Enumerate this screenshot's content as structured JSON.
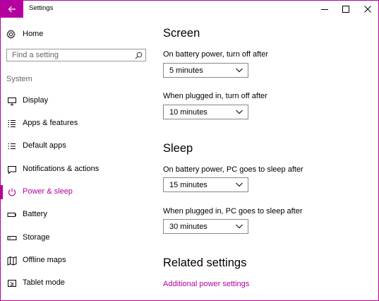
{
  "window": {
    "title": "Settings",
    "accent": "#b4009e"
  },
  "sidebar": {
    "home_label": "Home",
    "search_placeholder": "Find a setting",
    "section_label": "System",
    "items": [
      {
        "label": "Display",
        "icon": "monitor-icon"
      },
      {
        "label": "Apps & features",
        "icon": "list-icon"
      },
      {
        "label": "Default apps",
        "icon": "default-apps-icon"
      },
      {
        "label": "Notifications & actions",
        "icon": "message-icon"
      },
      {
        "label": "Power & sleep",
        "icon": "power-icon",
        "active": true
      },
      {
        "label": "Battery",
        "icon": "battery-icon"
      },
      {
        "label": "Storage",
        "icon": "storage-icon"
      },
      {
        "label": "Offline maps",
        "icon": "map-icon"
      },
      {
        "label": "Tablet mode",
        "icon": "tablet-icon"
      }
    ]
  },
  "main": {
    "screen": {
      "heading": "Screen",
      "battery_label": "On battery power, turn off after",
      "battery_value": "5 minutes",
      "plugged_label": "When plugged in, turn off after",
      "plugged_value": "10 minutes"
    },
    "sleep": {
      "heading": "Sleep",
      "battery_label": "On battery power, PC goes to sleep after",
      "battery_value": "15 minutes",
      "plugged_label": "When plugged in, PC goes to sleep after",
      "plugged_value": "30 minutes"
    },
    "related": {
      "heading": "Related settings",
      "link_label": "Additional power settings"
    }
  }
}
